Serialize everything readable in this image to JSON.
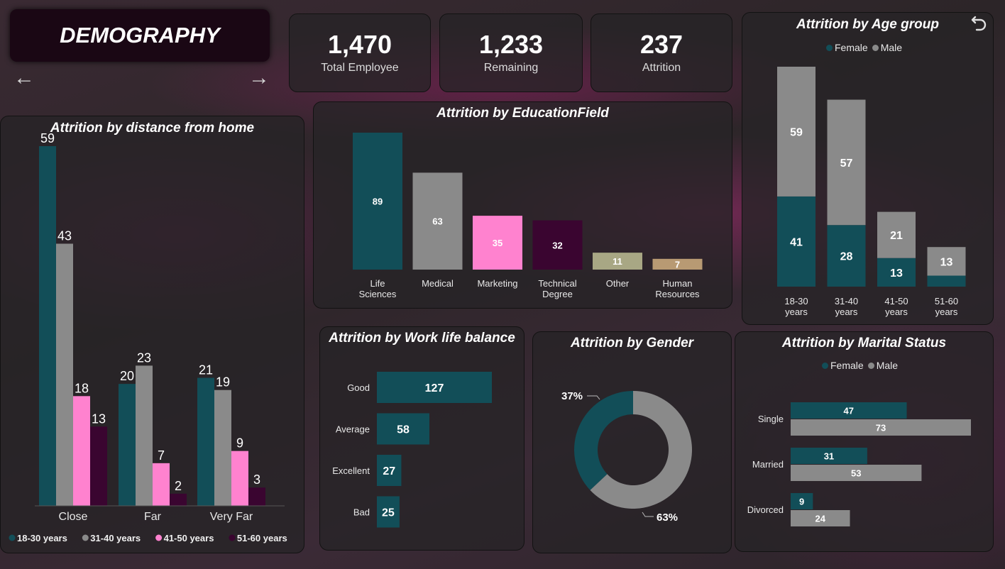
{
  "page_title": "DEMOGRAPHY",
  "kpis": [
    {
      "value": "1,470",
      "label": "Total Employee"
    },
    {
      "value": "1,233",
      "label": "Remaining"
    },
    {
      "value": "237",
      "label": "Attrition"
    }
  ],
  "colors": {
    "teal": "#124e58",
    "gray": "#8a8a8a",
    "pink": "#ff82cf",
    "plum": "#3a0530",
    "olive": "#a8a784",
    "tan": "#b89a73"
  },
  "chart_data": [
    {
      "id": "distance",
      "type": "bar",
      "title": "Attrition by distance from home",
      "categories": [
        "Close",
        "Far",
        "Very Far"
      ],
      "series": [
        {
          "name": "18-30 years",
          "color": "#124e58",
          "values": [
            59,
            20,
            21
          ]
        },
        {
          "name": "31-40 years",
          "color": "#8a8a8a",
          "values": [
            43,
            23,
            19
          ]
        },
        {
          "name": "41-50 years",
          "color": "#ff82cf",
          "values": [
            18,
            7,
            9
          ]
        },
        {
          "name": "51-60 years",
          "color": "#3a0530",
          "values": [
            13,
            2,
            3
          ]
        }
      ],
      "ylim": [
        0,
        59
      ],
      "legend": "bottom"
    },
    {
      "id": "education",
      "type": "bar",
      "title": "Attrition by EducationField",
      "categories": [
        "Life Sciences",
        "Medical",
        "Marketing",
        "Technical Degree",
        "Other",
        "Human Resources"
      ],
      "values": [
        89,
        63,
        35,
        32,
        11,
        7
      ],
      "colors": [
        "#124e58",
        "#8a8a8a",
        "#ff82cf",
        "#3a0530",
        "#a8a784",
        "#b89a73"
      ]
    },
    {
      "id": "age",
      "type": "bar",
      "stacked": true,
      "title": "Attrition by Age group",
      "categories": [
        "18-30 years",
        "31-40 years",
        "41-50 years",
        "51-60 years"
      ],
      "series": [
        {
          "name": "Female",
          "color": "#124e58",
          "values": [
            41,
            28,
            13,
            5
          ]
        },
        {
          "name": "Male",
          "color": "#8a8a8a",
          "values": [
            59,
            57,
            21,
            13
          ]
        }
      ],
      "legend": "top"
    },
    {
      "id": "worklife",
      "type": "bar",
      "orientation": "horizontal",
      "title": "Attrition by Work life balance",
      "categories": [
        "Good",
        "Average",
        "Excellent",
        "Bad"
      ],
      "values": [
        127,
        58,
        27,
        25
      ]
    },
    {
      "id": "gender",
      "type": "pie",
      "donut": true,
      "title": "Attrition by Gender",
      "labels": [
        "Female",
        "Male"
      ],
      "values": [
        37,
        63
      ],
      "display": [
        "37%",
        "63%"
      ],
      "colors": [
        "#124e58",
        "#8a8a8a"
      ]
    },
    {
      "id": "marital",
      "type": "bar",
      "orientation": "horizontal",
      "title": "Attrition by Marital Status",
      "categories": [
        "Single",
        "Married",
        "Divorced"
      ],
      "series": [
        {
          "name": "Female",
          "color": "#124e58",
          "values": [
            47,
            31,
            9
          ]
        },
        {
          "name": "Male",
          "color": "#8a8a8a",
          "values": [
            73,
            53,
            24
          ]
        }
      ],
      "legend": "top"
    }
  ]
}
